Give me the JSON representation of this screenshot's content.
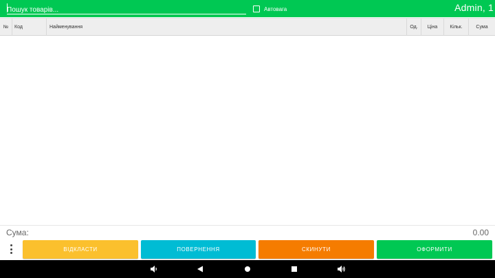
{
  "search": {
    "placeholder": "Пошук товарів..."
  },
  "autoweight": {
    "label": "Автовага",
    "checked": false
  },
  "user": {
    "label": "Admin, 1"
  },
  "table": {
    "columns": [
      "№",
      "Код",
      "Найменування",
      "Од.",
      "Ціна",
      "Кільк.",
      "Сума"
    ],
    "rows": []
  },
  "totals": {
    "label": "Сума:",
    "value": "0.00"
  },
  "actions": {
    "menu_icon": "more-vert-icon",
    "defer": "ВІДКЛАСТИ",
    "return": "ПОВЕРНЕННЯ",
    "reset": "СКИНУТИ",
    "checkout": "ОФОРМИТИ"
  },
  "navbar": {
    "icons": [
      "volume-down-icon",
      "back-icon",
      "home-icon",
      "recents-icon",
      "volume-up-icon"
    ]
  },
  "colors": {
    "topbar": "#00c853",
    "defer": "#fbc02d",
    "return": "#00bcd4",
    "reset": "#f57c00",
    "checkout": "#00c853",
    "navbar": "#000000"
  }
}
